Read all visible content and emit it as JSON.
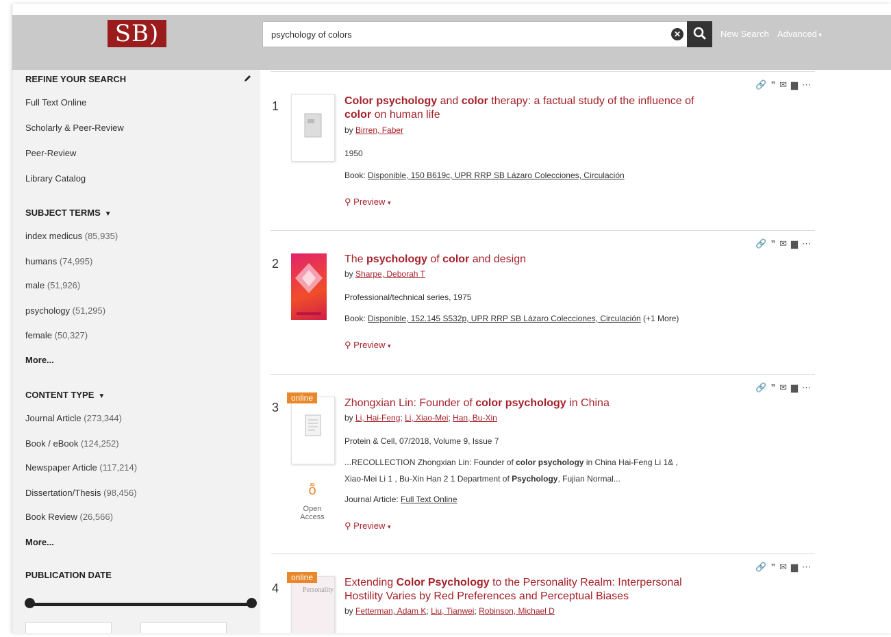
{
  "header": {
    "logo_text": "SB)",
    "search_value": "psychology of colors",
    "new_search": "New Search",
    "advanced": "Advanced"
  },
  "sidebar": {
    "refine_heading": "REFINE YOUR SEARCH",
    "filters": [
      "Full Text Online",
      "Scholarly & Peer-Review",
      "Peer-Review",
      "Library Catalog"
    ],
    "subject_heading": "SUBJECT TERMS",
    "subjects": [
      {
        "label": "index medicus",
        "count": "(85,935)"
      },
      {
        "label": "humans",
        "count": "(74,995)"
      },
      {
        "label": "male",
        "count": "(51,926)"
      },
      {
        "label": "psychology",
        "count": "(51,295)"
      },
      {
        "label": "female",
        "count": "(50,327)"
      }
    ],
    "more1": "More...",
    "content_heading": "CONTENT TYPE",
    "content_types": [
      {
        "label": "Journal Article",
        "count": "(273,344)"
      },
      {
        "label": "Book / eBook",
        "count": "(124,252)"
      },
      {
        "label": "Newspaper Article",
        "count": "(117,214)"
      },
      {
        "label": "Dissertation/Thesis",
        "count": "(98,456)"
      },
      {
        "label": "Book Review",
        "count": "(26,566)"
      }
    ],
    "more2": "More...",
    "pubdate_heading": "PUBLICATION DATE"
  },
  "results": [
    {
      "num": "1",
      "title_parts": [
        "Color psychology",
        " and ",
        "color",
        " therapy: a factual study of the influence of ",
        "color",
        " on human life"
      ],
      "author": "Birren, Faber",
      "meta": "1950",
      "avail_prefix": "Book: ",
      "avail_link": "Disponible, 150 B619c, UPR RRP SB Lázaro Colecciones, Circulación",
      "preview": "Preview"
    },
    {
      "num": "2",
      "title_parts": [
        "The ",
        "psychology",
        " of ",
        "color",
        " and design"
      ],
      "author": "Sharpe, Deborah T",
      "meta": "Professional/technical series, 1975",
      "avail_prefix": "Book: ",
      "avail_link": "Disponible, 152.145 S532p, UPR RRP SB Lázaro Colecciones, Circulación",
      "avail_suffix": " (+1 More)",
      "preview": "Preview"
    },
    {
      "num": "3",
      "online": "online",
      "title_parts": [
        "Zhongxian Lin: Founder of ",
        "color psychology",
        " in China"
      ],
      "authors": [
        "Li, Hai-Feng",
        "Li, Xiao-Mei",
        "Han, Bu-Xin"
      ],
      "meta": "Protein & Cell, 07/2018, Volume 9, Issue 7",
      "snippet1_pre": "...RECOLLECTION Zhongxian Lin: Founder of ",
      "snippet1_bold": "color psychology",
      "snippet1_post": " in China Hai-Feng Li 1& ,",
      "snippet2_pre": "Xiao-Mei Li 1 , Bu-Xin Han 2 1 Department of ",
      "snippet2_bold": "Psychology",
      "snippet2_post": ", Fujian Normal...",
      "avail_prefix": "Journal Article: ",
      "avail_link": "Full Text Online",
      "open_access": "Open Access",
      "preview": "Preview"
    },
    {
      "num": "4",
      "online": "online",
      "title_parts": [
        "Extending ",
        "Color Psychology",
        " to the Personality Realm: Interpersonal Hostility Varies by Red Preferences and Perceptual Biases"
      ],
      "authors": [
        "Fetterman, Adam K",
        "Liu, Tianwei",
        "Robinson, Michael D"
      ],
      "cover_text": "Personality"
    }
  ]
}
